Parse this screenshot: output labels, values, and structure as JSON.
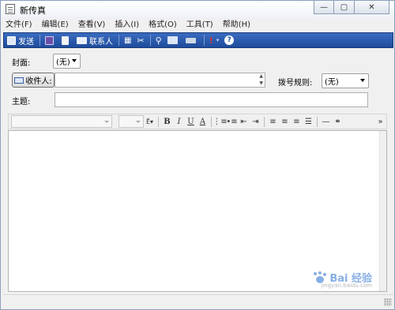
{
  "window": {
    "title": "新传真"
  },
  "menu": [
    "文件(F)",
    "编辑(E)",
    "查看(V)",
    "插入(I)",
    "格式(O)",
    "工具(T)",
    "帮助(H)"
  ],
  "toolbar": {
    "send_label": "发送",
    "contacts_label": "联系人"
  },
  "form": {
    "cover_label": "封面:",
    "cover_value": "(无)",
    "recipient_button": "收件人:",
    "dialing_rule_label": "拨号规则:",
    "dialing_rule_value": "(无)",
    "subject_label": "主题:"
  },
  "format_bar": {
    "bold": "B",
    "italic": "I",
    "underline": "U",
    "font_color": "A",
    "more": "»"
  },
  "watermark": {
    "text": "Bai 经验",
    "sub": "jingyan.baidu.com"
  },
  "colors": {
    "toolbar": "#2a5aab",
    "accent": "#3a7bd5"
  }
}
